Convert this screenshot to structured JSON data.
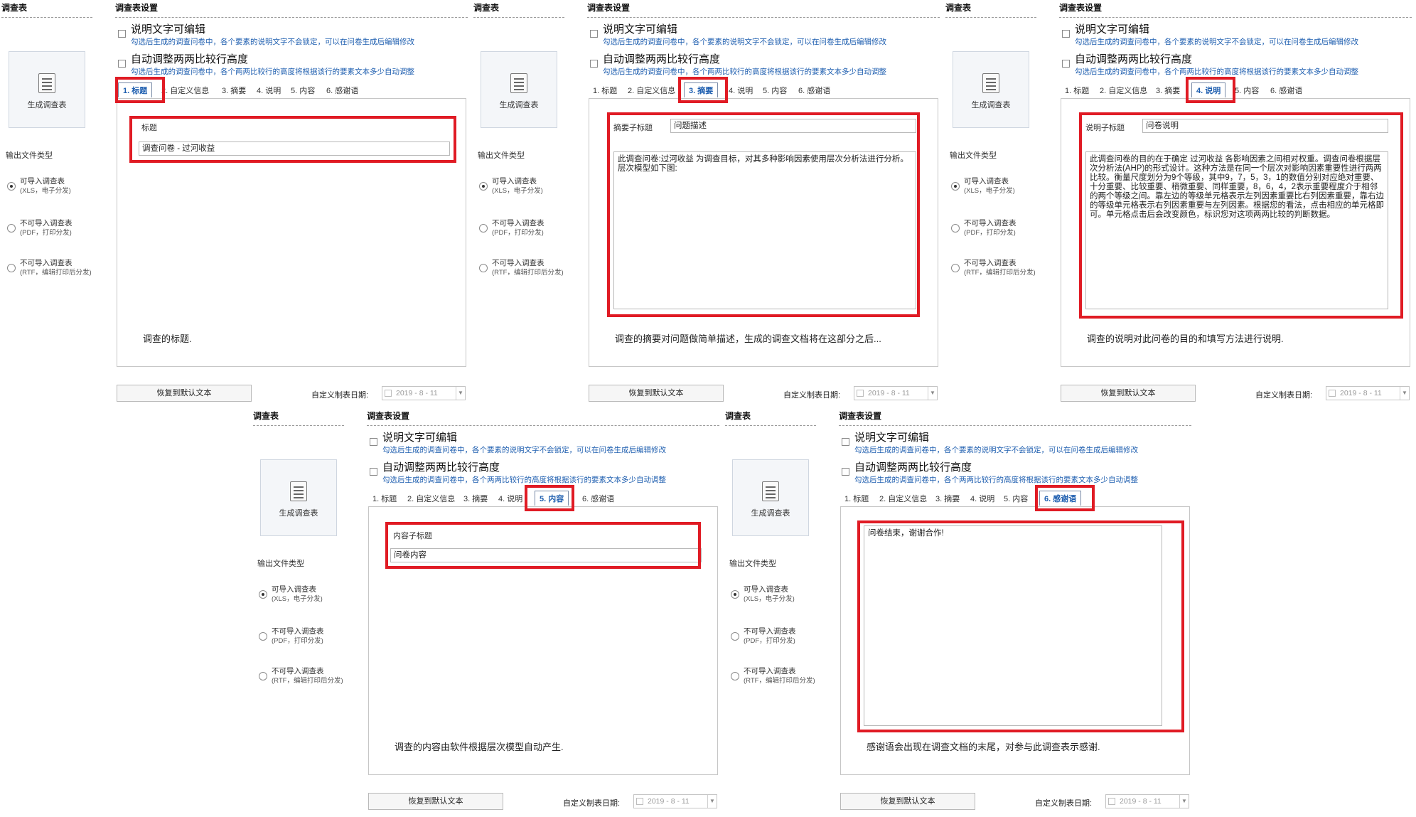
{
  "common": {
    "left_header": "调查表",
    "settings_header": "调查表设置",
    "generate_button": "生成调查表",
    "output_label": "输出文件类型",
    "radios": [
      {
        "title": "可导入调查表",
        "sub": "(XLS，电子分发)",
        "selected": true
      },
      {
        "title": "不可导入调查表",
        "sub": "(PDF，打印分发)",
        "selected": false
      },
      {
        "title": "不可导入调查表",
        "sub": "(RTF，编辑打印后分发)",
        "selected": false
      }
    ],
    "option1_title": "说明文字可编辑",
    "option1_desc": "勾选后生成的调查问卷中，各个要素的说明文字不会锁定，可以在问卷生成后编辑修改",
    "option2_title": "自动调整两两比较行高度",
    "option2_desc": "勾选后生成的调查问卷中，各个两两比较行的高度将根据该行的要素文本多少自动调整",
    "tabs": [
      "1. 标题",
      "2. 自定义信息",
      "3. 摘要",
      "4. 说明",
      "5. 内容",
      "6. 感谢语"
    ],
    "restore_button": "恢复到默认文本",
    "date_label": "自定义制表日期:",
    "date_value": "2019 - 8 - 11"
  },
  "highlight_color": "#e01b24",
  "panels": [
    {
      "active_tab": "1.  标题",
      "sub_label": "标题",
      "input_value": "调查问卷 - 过河收益",
      "description": "调查的标题."
    },
    {
      "active_tab": "3.  摘要",
      "sub_label": "摘要子标题",
      "input_value": "问题描述",
      "body_text": "此调查问卷:过河收益 为调查目标，对其多种影响因素使用层次分析法进行分析。层次模型如下图:",
      "description": "调查的摘要对问题做简单描述，生成的调查文档将在这部分之后..."
    },
    {
      "active_tab": "4.  说明",
      "sub_label": "说明子标题",
      "input_value": "问卷说明",
      "body_text": "此调查问卷的目的在于确定 过河收益 各影响因素之间相对权重。调查问卷根据层次分析法(AHP)的形式设计。这种方法是在同一个层次对影响因素重要性进行两两比较。衡量尺度划分为9个等级，其中9，7，5，3，1的数值分别对应绝对重要、十分重要、比较重要、稍微重要、同样重要，8，6，4，2表示重要程度介于相邻的两个等级之间。靠左边的等级单元格表示左列因素重要比右列因素重要，靠右边的等级单元格表示右列因素重要与左列因素。根据您的看法，点击相应的单元格即可。单元格点击后会改变颜色，标识您对这项两两比较的判断数据。",
      "description": "调查的说明对此问卷的目的和填写方法进行说明."
    },
    {
      "active_tab": "5.  内容",
      "sub_label": "内容子标题",
      "input_value": "问卷内容",
      "description": "调查的内容由软件根据层次模型自动产生."
    },
    {
      "active_tab": "6.  感谢语",
      "body_text": "问卷结束，谢谢合作!",
      "description": "感谢语会出现在调查文档的末尾，对参与此调查表示感谢."
    }
  ]
}
